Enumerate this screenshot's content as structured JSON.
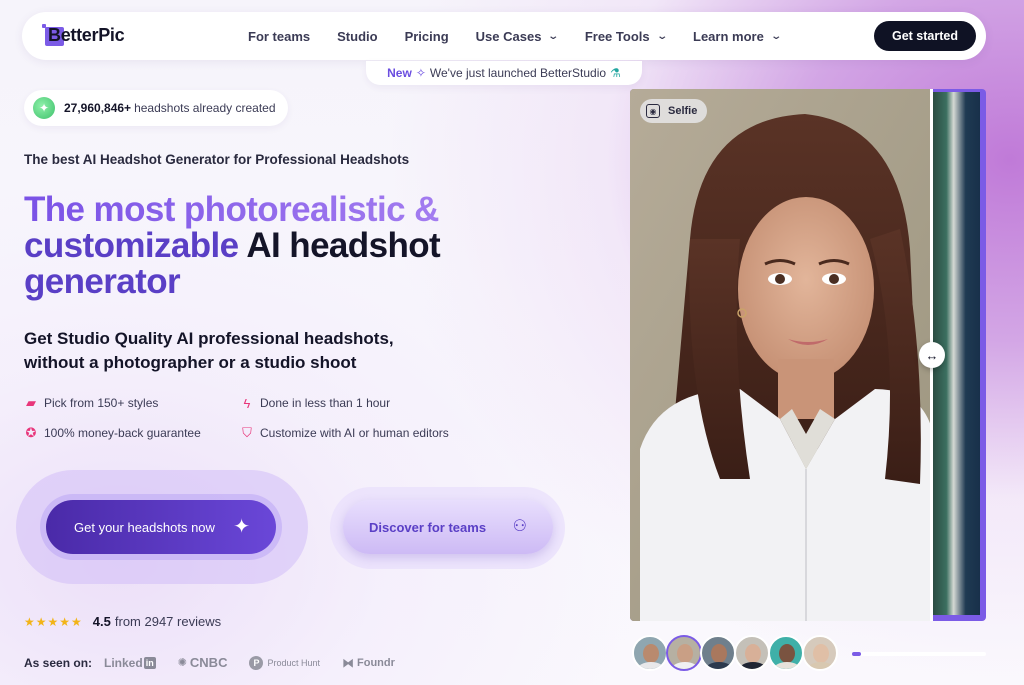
{
  "nav": {
    "logo": "BetterPic",
    "links": [
      {
        "label": "For teams",
        "dropdown": false
      },
      {
        "label": "Studio",
        "dropdown": false
      },
      {
        "label": "Pricing",
        "dropdown": false
      },
      {
        "label": "Use Cases",
        "dropdown": true
      },
      {
        "label": "Free Tools",
        "dropdown": true
      },
      {
        "label": "Learn more",
        "dropdown": true
      }
    ],
    "cta": "Get started"
  },
  "announcement": {
    "badge": "New",
    "message": "We've just launched BetterStudio"
  },
  "counter": {
    "count": "27,960,846+",
    "label": "headshots already created"
  },
  "hero": {
    "tagline": "The best AI Headshot Generator for Professional Headshots",
    "headline_part1": "The most photorealistic &",
    "headline_part2": "customizable",
    "headline_part3": "AI headshot",
    "headline_part4": "generator",
    "subhead": "Get Studio Quality AI professional headshots, without a photographer or a studio shoot"
  },
  "features": [
    {
      "label": "Pick from 150+ styles",
      "icon": "book-icon"
    },
    {
      "label": "Done in less than 1 hour",
      "icon": "lightning-icon"
    },
    {
      "label": "100% money-back guarantee",
      "icon": "medal-icon"
    },
    {
      "label": "Customize with AI or human editors",
      "icon": "shield-check-icon"
    }
  ],
  "buttons": {
    "primary": "Get your headshots now",
    "secondary": "Discover for teams"
  },
  "rating": {
    "stars": 4.5,
    "value": "4.5",
    "text": "from 2947 reviews"
  },
  "press": {
    "label": "As seen on:",
    "logos": [
      "Linked",
      "in",
      "CNBC",
      "Product Hunt",
      "Foundr"
    ]
  },
  "photo": {
    "badge": "Selfie"
  },
  "carousel": {
    "thumbs": [
      {
        "skin": "#b98a6e",
        "shirt": "#e8e8ea",
        "bg": "#8fa6b0"
      },
      {
        "skin": "#c99f85",
        "shirt": "#f0f0f2",
        "bg": "#b6b0a2"
      },
      {
        "skin": "#a9785e",
        "shirt": "#2c3a4e",
        "bg": "#6f7f8c"
      },
      {
        "skin": "#d8b098",
        "shirt": "#1f2533",
        "bg": "#c4c0b8"
      },
      {
        "skin": "#7a5340",
        "shirt": "#e6e2da",
        "bg": "#3fb0a8"
      },
      {
        "skin": "#e0bfa6",
        "shirt": "#d8c8b0",
        "bg": "#d6cabc"
      }
    ],
    "active_index": 1,
    "progress": 0.07
  },
  "colors": {
    "accent": "#7b5be6",
    "dark": "#0f1224",
    "star": "#f2b418"
  }
}
